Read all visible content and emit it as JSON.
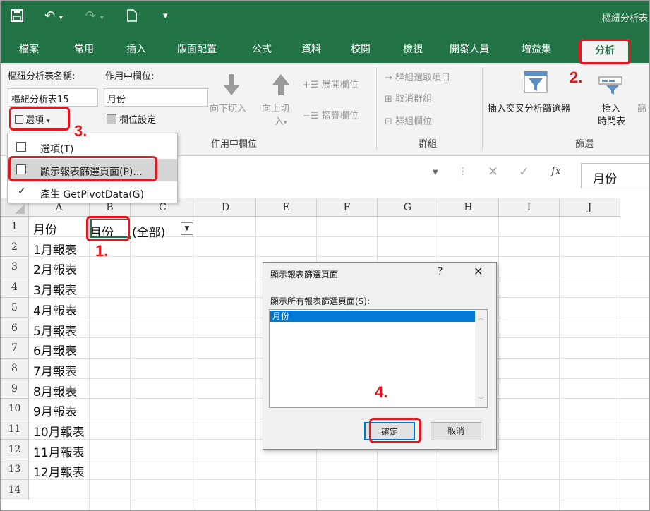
{
  "title_bar": {
    "save_icon": "save-icon",
    "undo_icon": "undo-icon",
    "redo_icon": "redo-icon",
    "new_icon": "new-document-icon",
    "customize_icon": "customize-qat-icon",
    "title": "樞紐分析表"
  },
  "tabs": [
    "檔案",
    "常用",
    "插入",
    "版面配置",
    "公式",
    "資料",
    "校閱",
    "檢視",
    "開發人員",
    "增益集",
    "分析"
  ],
  "ribbon": {
    "pivot_name_label": "樞紐分析表名稱:",
    "pivot_name_value": "樞紐分析表15",
    "options_button": "選項",
    "active_field_label": "作用中欄位:",
    "active_field_value": "月份",
    "field_settings": "欄位設定",
    "drill_down": "向下切入",
    "drill_up_1": "向上切",
    "drill_up_2": "入",
    "expand_field": "展開欄位",
    "collapse_field": "摺疊欄位",
    "active_field_group": "作用中欄位",
    "group_selection": "群組選取項目",
    "ungroup": "取消群組",
    "group_field": "群組欄位",
    "group_group": "群組",
    "insert_slicer": "插入交叉分析篩選器",
    "insert_timeline_1": "插入",
    "insert_timeline_2": "時間表",
    "filter_group": "篩選",
    "filter_conn_partial": "篩"
  },
  "menu": {
    "items": [
      {
        "label": "選項(T)"
      },
      {
        "label": "顯示報表篩選頁面(P)..."
      },
      {
        "label": "產生 GetPivotData(G)"
      }
    ]
  },
  "formula_bar": {
    "value": "月份"
  },
  "grid": {
    "columns": [
      "A",
      "B",
      "C",
      "D",
      "E",
      "F",
      "G",
      "H",
      "I",
      "J"
    ],
    "rows": [
      "1",
      "2",
      "3",
      "4",
      "5",
      "6",
      "7",
      "8",
      "9",
      "10",
      "11",
      "12",
      "13",
      "14"
    ],
    "a_values": [
      "月份",
      "1月報表",
      "2月報表",
      "3月報表",
      "4月報表",
      "5月報表",
      "6月報表",
      "7月報表",
      "8月報表",
      "9月報表",
      "10月報表",
      "11月報表",
      "12月報表",
      ""
    ],
    "b1": "月份",
    "c1": "(全部)"
  },
  "dialog": {
    "title": "顯示報表篩選頁面",
    "help": "?",
    "label": "顯示所有報表篩選頁面(S):",
    "list_items": [
      "月份"
    ],
    "ok": "確定",
    "cancel": "取消"
  },
  "annotations": {
    "step1": "1.",
    "step2": "2.",
    "step3": "3.",
    "step4": "4.",
    "color": "#e8141e"
  }
}
